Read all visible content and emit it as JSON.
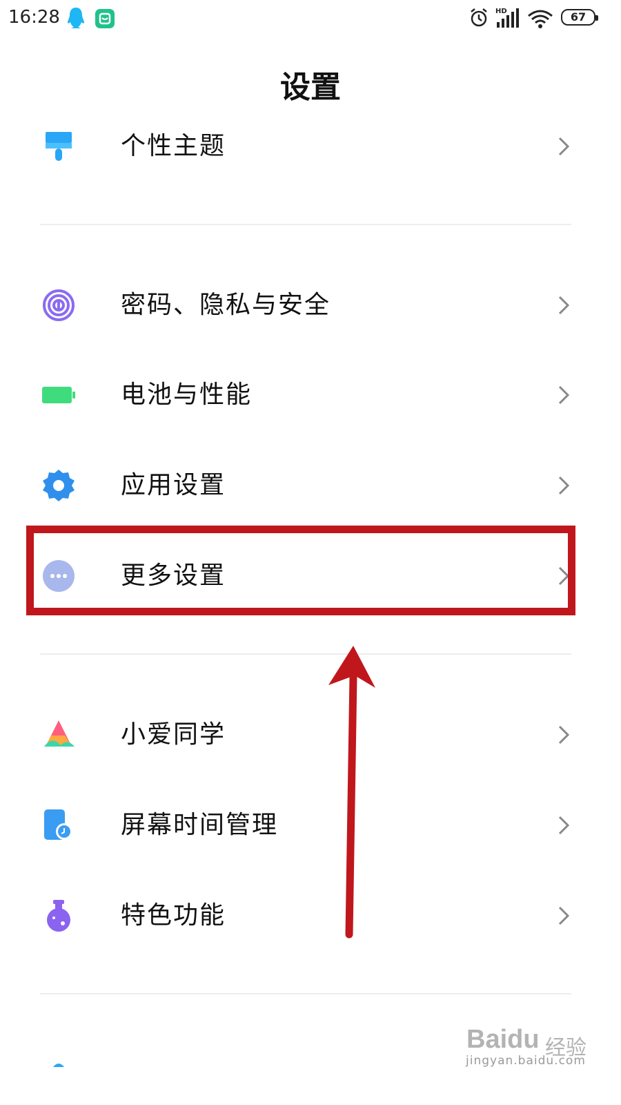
{
  "status_bar": {
    "time": "16:28",
    "battery": "67",
    "network_label": "HD",
    "icons": [
      "qq-icon",
      "xiaomi-app-icon",
      "alarm-icon",
      "signal-icon",
      "wifi-icon",
      "battery-icon"
    ]
  },
  "header": {
    "title": "设置"
  },
  "items": [
    {
      "label": "个性主题",
      "icon": "paint-brush-icon",
      "color": "#2aa6f6"
    },
    {
      "label": "密码、隐私与安全",
      "icon": "fingerprint-icon",
      "color": "#8b6bf0"
    },
    {
      "label": "电池与性能",
      "icon": "battery-icon",
      "color": "#3fdc7e"
    },
    {
      "label": "应用设置",
      "icon": "gear-icon",
      "color": "#2f8fec"
    },
    {
      "label": "更多设置",
      "icon": "more-dots-icon",
      "color": "#a8b7ec"
    },
    {
      "label": "小爱同学",
      "icon": "xiaoai-icon",
      "color": "#ff5f7e"
    },
    {
      "label": "屏幕时间管理",
      "icon": "screen-time-icon",
      "color": "#3a9cf2"
    },
    {
      "label": "特色功能",
      "icon": "potion-icon",
      "color": "#8a63f0"
    }
  ],
  "annotation": {
    "highlight_color": "#c0171c",
    "arrow_color": "#c0171c"
  },
  "watermark": {
    "brand": "Baidu",
    "cn": "经验",
    "url": "jingyan.baidu.com"
  }
}
